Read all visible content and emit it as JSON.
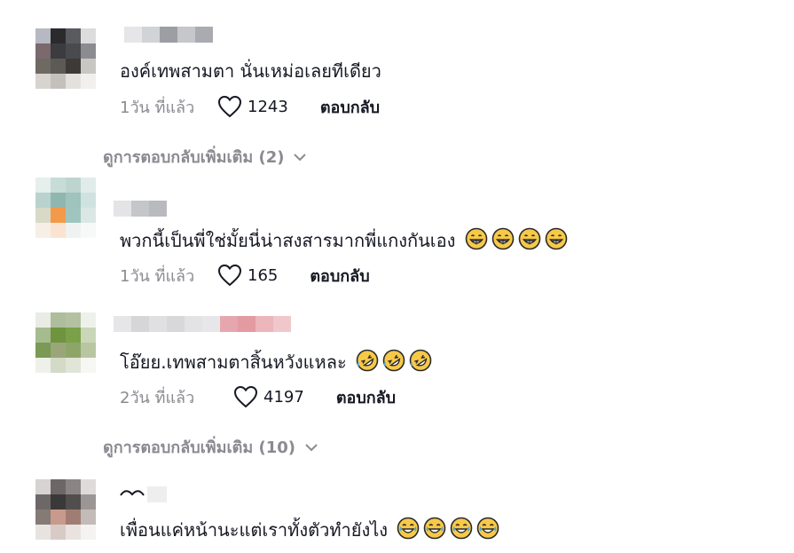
{
  "comments": [
    {
      "text": "องค์เทพสามตา นั่นเหม่อเลยทีเดียว",
      "time": "1วัน ที่แล้ว",
      "likes": "1243",
      "reply_label": "ตอบกลับ",
      "emoji_icon": "grin-emoji-icon"
    },
    {
      "text": "พวกนี้เป็นพี่ใช่มั้ยนี่น่าสงสารมากพี่แกงกันเอง",
      "time": "1วัน ที่แล้ว",
      "likes": "165",
      "reply_label": "ตอบกลับ",
      "emoji_icon": "grin-emoji-icon"
    },
    {
      "text": "โอ๊ยย.เทพสามตาสิ้นหวังแหละ",
      "time": "2วัน ที่แล้ว",
      "likes": "4197",
      "reply_label": "ตอบกลับ",
      "emoji_icon": "rolling-laugh-emoji-icon"
    },
    {
      "text": "เพื่อนแค่หน้านะแต่เราทั้งตัวทำยังไง",
      "emoji_icon": "tears-of-joy-emoji-icon"
    }
  ],
  "more_replies": [
    "ดูการตอบกลับเพิ่มเติม (2)",
    "ดูการตอบกลับเพิ่มเติม (10)"
  ],
  "colors": {
    "text": "#161823",
    "muted": "#8a8b91",
    "emoji_face": "#f7c948",
    "emoji_outline": "#2a2a2a"
  }
}
